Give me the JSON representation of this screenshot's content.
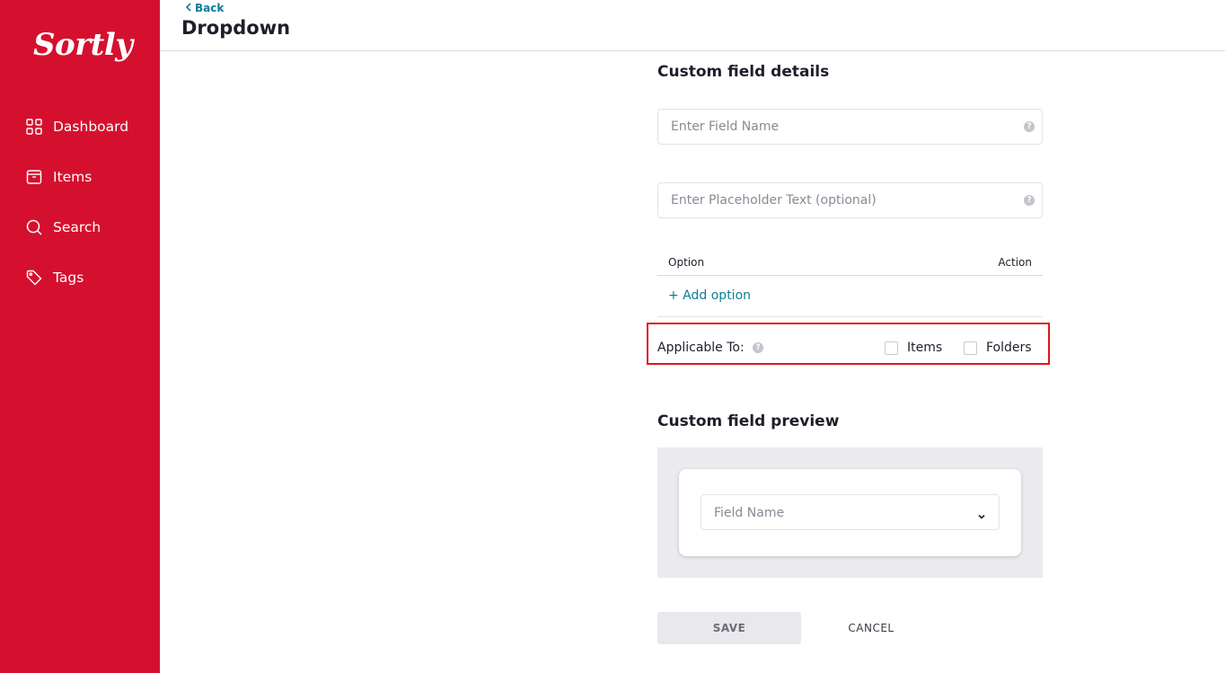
{
  "app": {
    "logo_text": "Sortly",
    "brand_color": "#d5102f",
    "accent_color": "#0b7d99",
    "highlight_color": "#e0151b"
  },
  "sidebar": {
    "items": [
      {
        "label": "Dashboard",
        "icon": "dashboard-grid-icon"
      },
      {
        "label": "Items",
        "icon": "box-icon"
      },
      {
        "label": "Search",
        "icon": "search-icon"
      },
      {
        "label": "Tags",
        "icon": "tag-icon"
      }
    ]
  },
  "header": {
    "back_label": "Back",
    "title": "Dropdown"
  },
  "details": {
    "title": "Custom field details",
    "field_name_placeholder": "Enter Field Name",
    "placeholder_text_placeholder": "Enter Placeholder Text (optional)",
    "options_table": {
      "col_option": "Option",
      "col_action": "Action"
    },
    "add_option_label": "+ Add option",
    "applicable_to": {
      "label": "Applicable To:",
      "options": [
        {
          "label": "Items",
          "checked": false
        },
        {
          "label": "Folders",
          "checked": false
        }
      ]
    }
  },
  "preview": {
    "title": "Custom field preview",
    "select_placeholder": "Field Name"
  },
  "actions": {
    "save_label": "SAVE",
    "cancel_label": "CANCEL"
  }
}
